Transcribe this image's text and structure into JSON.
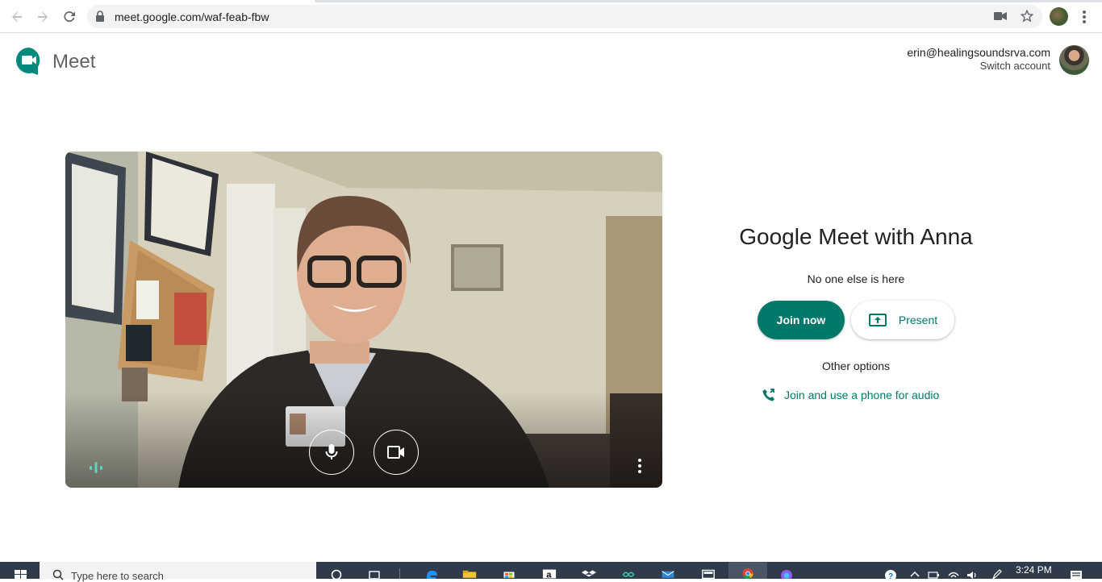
{
  "browser": {
    "url": "meet.google.com/waf-feab-fbw"
  },
  "header": {
    "app_name": "Meet",
    "account_email": "erin@healingsoundsrva.com",
    "switch_account": "Switch account"
  },
  "meeting": {
    "title": "Google Meet with Anna",
    "status": "No one else is here",
    "join_label": "Join now",
    "present_label": "Present",
    "other_options": "Other options",
    "phone_audio_label": "Join and use a phone for audio"
  },
  "preview": {
    "mic_icon": "microphone-icon",
    "camera_icon": "videocam-icon",
    "audio_indicator_icon": "audio-level-icon",
    "more_icon": "more-vert-icon"
  },
  "taskbar": {
    "search_placeholder": "Type here to search",
    "time": "3:24 PM"
  },
  "colors": {
    "accent": "#00796b",
    "taskbar": "#2f3b4a"
  }
}
